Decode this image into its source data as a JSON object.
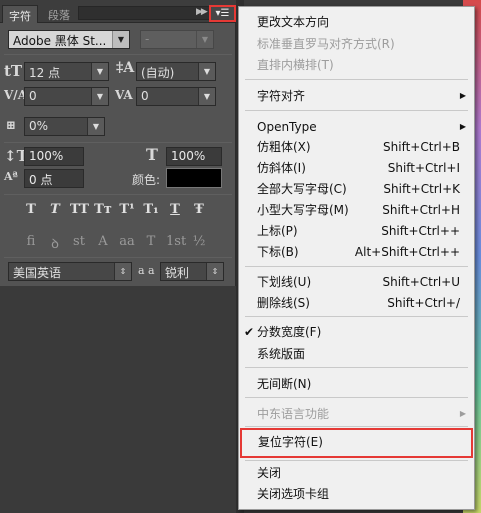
{
  "panel": {
    "tabs": [
      "字符",
      "段落"
    ],
    "font_family": "Adobe 黑体 St...",
    "font_style": "-",
    "font_size": "12 点",
    "leading": "(自动)",
    "kerning": "0",
    "tracking": "0",
    "tsume": "0%",
    "vertical_scale": "100%",
    "horizontal_scale": "100%",
    "baseline_shift": "0 点",
    "color_label": "颜色:",
    "color_value": "#000000",
    "language": "美国英语",
    "aa_label": "a a",
    "antialias": "锐利",
    "style_buttons": [
      "T",
      "T",
      "TT",
      "Tт",
      "T¹",
      "T₁",
      "T",
      "Ŧ"
    ],
    "opentype_buttons": [
      "fi",
      "ꝺ",
      "st",
      "A",
      "aa",
      "T",
      "1st",
      "½"
    ]
  },
  "menu": {
    "change_direction": "更改文本方向",
    "vertical_roman": "标准垂直罗马对齐方式(R)",
    "tate_chu_yoko": "直排内横排(T)",
    "char_align": "字符对齐",
    "opentype": "OpenType",
    "faux_bold": "仿粗体(X)",
    "faux_bold_sc": "Shift+Ctrl+B",
    "faux_italic": "仿斜体(I)",
    "faux_italic_sc": "Shift+Ctrl+I",
    "all_caps": "全部大写字母(C)",
    "all_caps_sc": "Shift+Ctrl+K",
    "small_caps": "小型大写字母(M)",
    "small_caps_sc": "Shift+Ctrl+H",
    "superscript": "上标(P)",
    "superscript_sc": "Shift+Ctrl++",
    "subscript": "下标(B)",
    "subscript_sc": "Alt+Shift+Ctrl++",
    "underline": "下划线(U)",
    "underline_sc": "Shift+Ctrl+U",
    "strikethrough": "删除线(S)",
    "strikethrough_sc": "Shift+Ctrl+/",
    "fractional_widths": "分数宽度(F)",
    "system_layout": "系统版面",
    "no_break": "无间断(N)",
    "middle_east": "中东语言功能",
    "reset_character": "复位字符(E)",
    "close": "关闭",
    "close_tab_group": "关闭选项卡组"
  },
  "colors": {
    "highlight": "#e53935",
    "menu_bg": "#f0f0f0",
    "panel_bg": "#535353"
  }
}
